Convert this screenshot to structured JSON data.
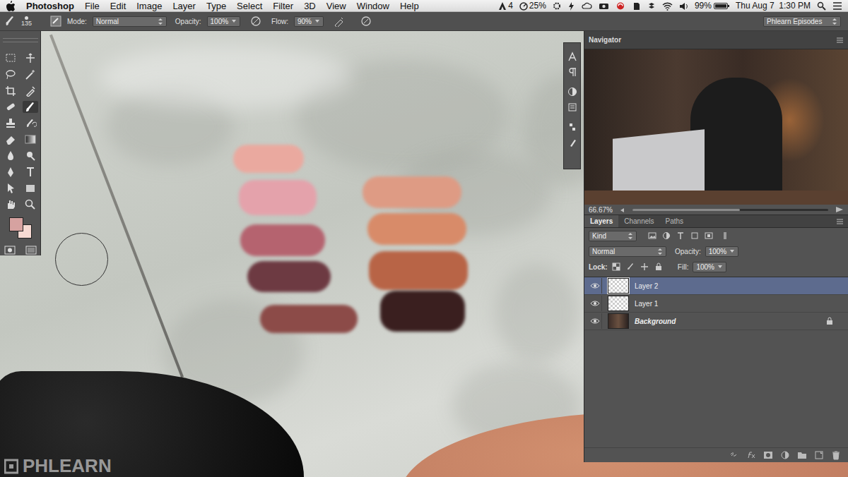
{
  "menubar": {
    "app": "Photoshop",
    "menus": [
      "File",
      "Edit",
      "Image",
      "Layer",
      "Type",
      "Select",
      "Filter",
      "3D",
      "View",
      "Window",
      "Help"
    ],
    "status": {
      "adobe": "4",
      "cpu": "25%",
      "battery": "99%",
      "clock": "Thu Aug 7  1:30 PM"
    }
  },
  "options": {
    "brush_size": "135",
    "mode_label": "Mode:",
    "mode": "Normal",
    "opacity_label": "Opacity:",
    "opacity": "100%",
    "flow_label": "Flow:",
    "flow": "90%",
    "workspace": "Phlearn Episodes"
  },
  "tools": {
    "foreground_color": "#d6a2a0",
    "background_color": "#f6d9d2"
  },
  "navigator": {
    "title": "Navigator",
    "zoom": "66.67%",
    "level": 0.55
  },
  "layers_panel": {
    "tabs": [
      {
        "label": "Layers",
        "selected": true
      },
      {
        "label": "Channels",
        "selected": false
      },
      {
        "label": "Paths",
        "selected": false
      }
    ],
    "filter": "Kind",
    "blend": "Normal",
    "opacity_label": "Opacity:",
    "opacity": "100%",
    "lock_label": "Lock:",
    "fill_label": "Fill:",
    "fill": "100%",
    "layers": [
      {
        "name": "Layer 2",
        "visible": true,
        "selected": true,
        "locked": false,
        "kind": "transparent"
      },
      {
        "name": "Layer 1",
        "visible": true,
        "selected": false,
        "locked": false,
        "kind": "transparent"
      },
      {
        "name": "Background",
        "visible": true,
        "selected": false,
        "locked": true,
        "kind": "background"
      }
    ]
  },
  "watermark": "PHLEARN"
}
